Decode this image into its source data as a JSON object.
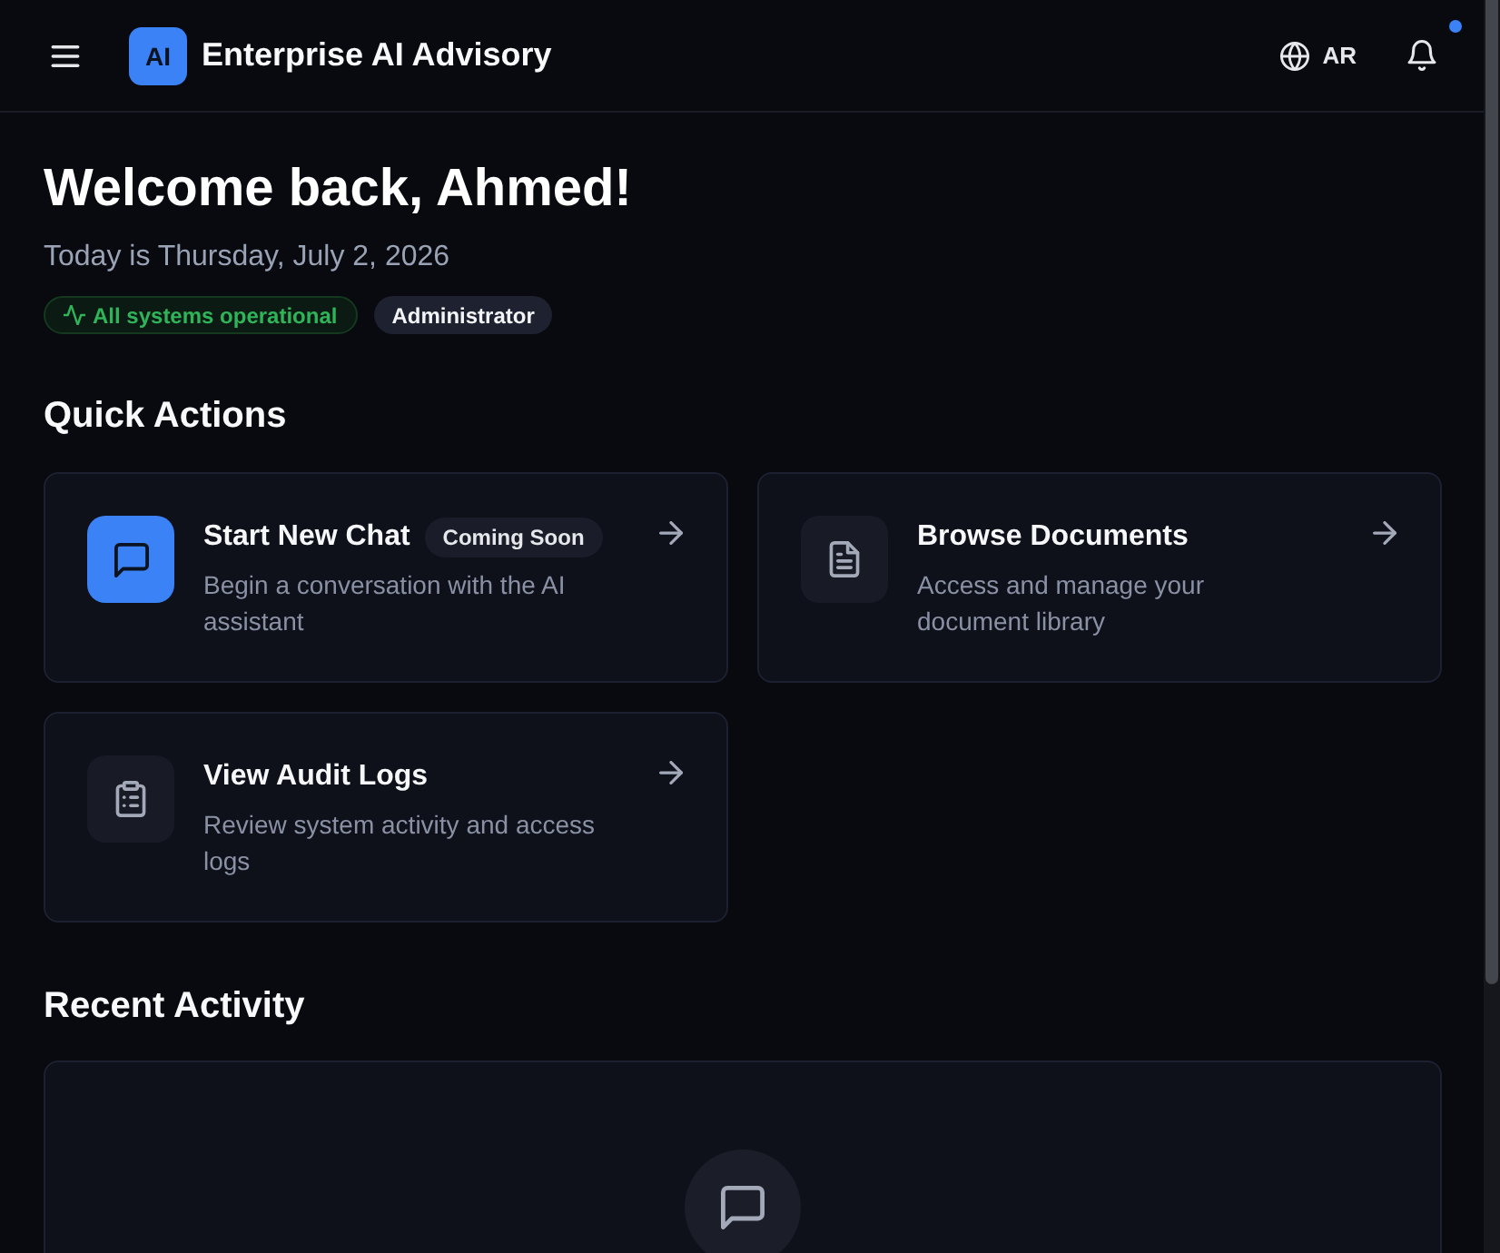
{
  "header": {
    "logo": "AI",
    "title": "Enterprise AI Advisory",
    "language": "AR",
    "notifications_unread": true
  },
  "welcome": {
    "title": "Welcome back, Ahmed!",
    "date": "Today is Thursday, July 2, 2026",
    "badges": [
      {
        "kind": "status",
        "label": "All systems operational"
      },
      {
        "kind": "role",
        "label": "Administrator"
      }
    ]
  },
  "quick_actions": {
    "title": "Quick Actions",
    "cards": [
      {
        "kind": "chat",
        "title": "Start New Chat",
        "badge": "Coming Soon",
        "description": "Begin a conversation with the AI assistant",
        "highlighted": true
      },
      {
        "kind": "document",
        "title": "Browse Documents",
        "description": "Access and manage your document library",
        "highlighted": false
      },
      {
        "kind": "audit",
        "title": "View Audit Logs",
        "description": "Review system activity and access logs",
        "highlighted": false
      }
    ]
  },
  "recent_activity": {
    "title": "Recent Activity"
  }
}
